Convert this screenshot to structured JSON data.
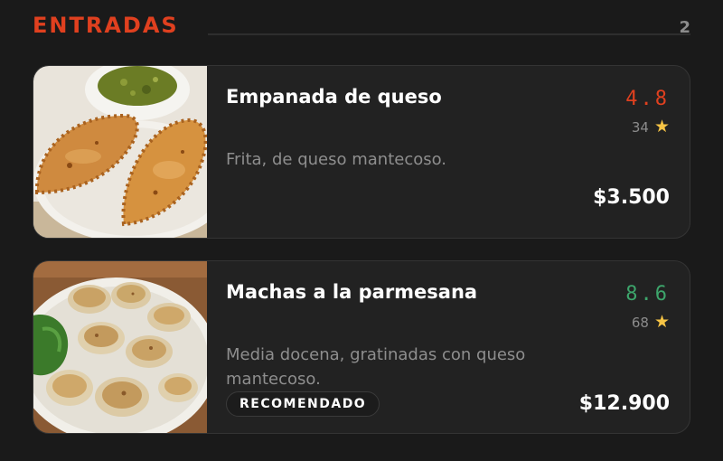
{
  "section": {
    "title": "ENTRADAS",
    "count": "2",
    "accent_color": "#e0401f"
  },
  "items": [
    {
      "name": "Empanada de queso",
      "rating": "4.8",
      "rating_color": "#e0401f",
      "votes": "34",
      "star_icon": "star-icon",
      "description": "Frita, de queso mantecoso.",
      "price": "$3.500",
      "image": "empanadas-photo"
    },
    {
      "name": "Machas a la parmesana",
      "rating": "8.6",
      "rating_color": "#3da56b",
      "votes": "68",
      "star_icon": "star-icon",
      "description": "Media docena, gratinadas con queso mantecoso.",
      "price": "$12.900",
      "badge": "RECOMENDADO",
      "image": "machas-photo"
    }
  ]
}
